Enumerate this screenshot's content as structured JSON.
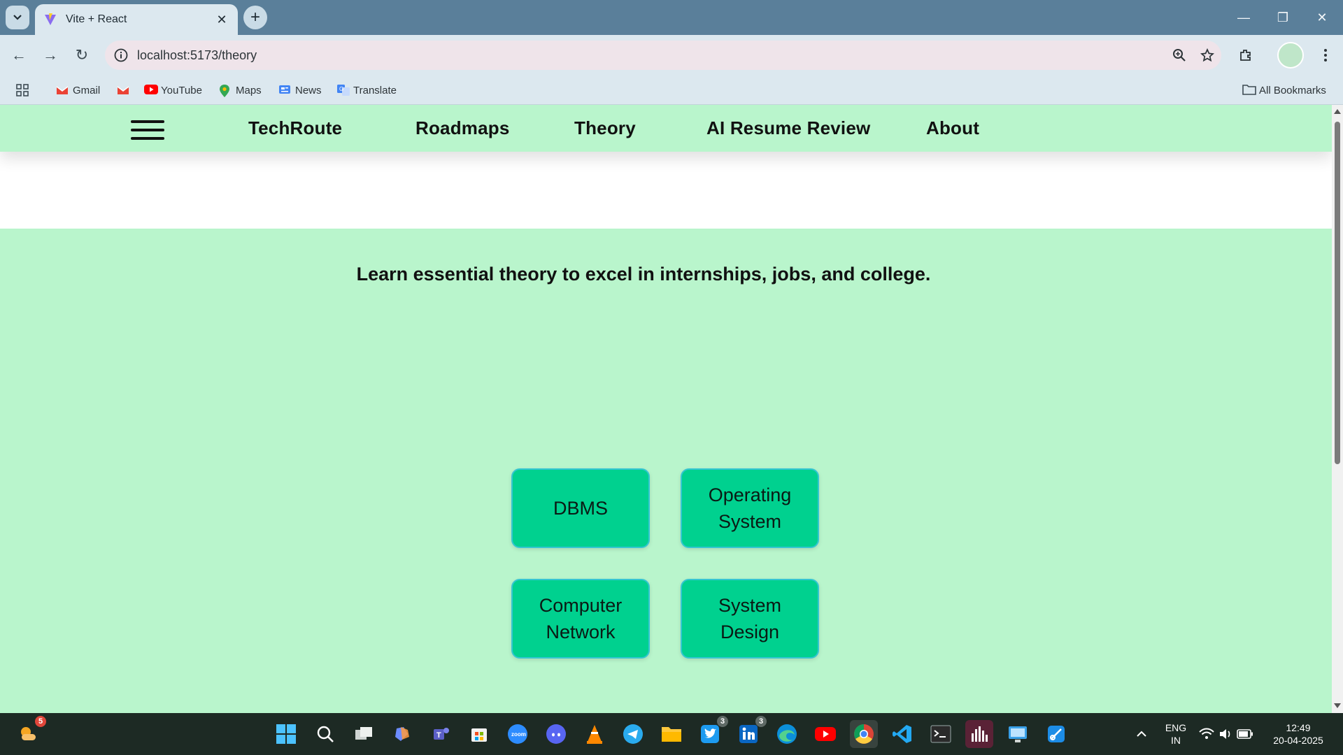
{
  "browser": {
    "tab_title": "Vite + React",
    "url": "localhost:5173/theory",
    "bookmarks": [
      {
        "label": "Gmail",
        "icon": "gmail-icon"
      },
      {
        "label": "",
        "icon": "gmail-icon"
      },
      {
        "label": "YouTube",
        "icon": "youtube-icon"
      },
      {
        "label": "Maps",
        "icon": "maps-icon"
      },
      {
        "label": "News",
        "icon": "news-icon"
      },
      {
        "label": "Translate",
        "icon": "translate-icon"
      }
    ],
    "all_bookmarks": "All Bookmarks"
  },
  "site": {
    "brand": "TechRoute",
    "nav": [
      "Roadmaps",
      "Theory",
      "AI Resume Review",
      "About"
    ],
    "tagline": "Learn essential theory to excel in internships, jobs, and college.",
    "topics": [
      "DBMS",
      "Operating System",
      "Computer Network",
      "System Design"
    ]
  },
  "taskbar": {
    "weather_badge": "5",
    "twitter_badge": "3",
    "linkedin_badge": "3",
    "lang_line1": "ENG",
    "lang_line2": "IN",
    "time": "12:49",
    "date": "20-04-2025"
  },
  "colors": {
    "page_bg": "#b9f5cc",
    "card_bg": "#00d18f",
    "card_border": "#34c6d2"
  }
}
